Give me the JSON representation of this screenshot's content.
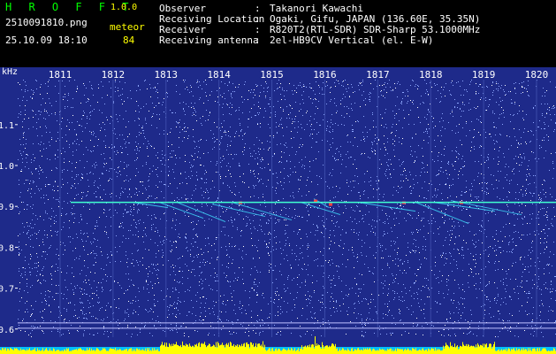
{
  "header": {
    "app_name": "H R O F F T",
    "version": "1.0.0",
    "filename": "2510091810.png",
    "meteor_label": "meteor",
    "datetime": "25.10.09 18:10",
    "meteor_count": "84",
    "info": [
      {
        "label": "Observer",
        "value": "Takanori Kawachi"
      },
      {
        "label": "Receiving Location",
        "value": "Ogaki, Gifu, JAPAN (136.60E, 35.35N)"
      },
      {
        "label": "Receiver",
        "value": "R820T2(RTL-SDR) SDR-Sharp 53.1000MHz"
      },
      {
        "label": "Receiving antenna",
        "value": "2el-HB9CV Vertical (el. E-W)"
      }
    ],
    "separator": ":"
  },
  "chart_data": {
    "type": "heatmap",
    "title": "",
    "xlabel": "",
    "ylabel": "kHz",
    "x_ticks": [
      "1811",
      "1812",
      "1813",
      "1814",
      "1815",
      "1816",
      "1817",
      "1818",
      "1819",
      "1820"
    ],
    "y_ticks": [
      "1.1",
      "1.0",
      "0.9",
      "0.8",
      "0.7",
      "0.6"
    ],
    "ylim": [
      0.58,
      1.21
    ],
    "carrier_khz": 0.91,
    "reference_lines_khz": [
      0.615,
      0.602
    ],
    "colors": {
      "background": "#1e2a8a",
      "noise_light": "#8ea8ff",
      "noise_white": "#ffffff",
      "carrier": "#40ffd0",
      "echo": "#40e0ff",
      "echo_hot": "#ff4040",
      "signal_bar": "#ffff00",
      "axis_text": "#ffffff",
      "grid": "#3a4aa8"
    }
  }
}
